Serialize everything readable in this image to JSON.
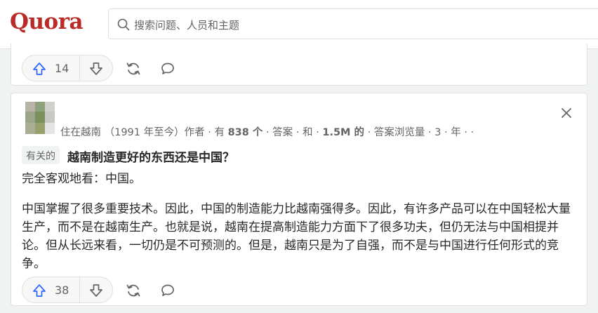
{
  "header": {
    "logo_text": "Quora",
    "search": {
      "placeholder": "搜索问题、人员和主题"
    }
  },
  "colors": {
    "brand": "#b92b27",
    "upvote_blue": "#2e69ff",
    "muted_text": "#636466",
    "border": "#dee0e1"
  },
  "previous_card": {
    "upvotes": "14"
  },
  "answer_card": {
    "author_line_plain": "住在越南 （1991 年至今）作者 · 有 ",
    "answers_count": "838 个",
    "author_line_mid": " · 答案 · 和 · ",
    "views_count": "1.5M 的",
    "author_line_end": " · 答案浏览量 · 3 · 年 · ·",
    "related_label": "有关的",
    "question": "越南制造更好的东西还是中国？",
    "paragraph_1": "完全客观地看：中国。",
    "paragraph_2": "中国掌握了很多重要技术。因此，中国的制造能力比越南强得多。因此，有许多产品可以在中国轻松大量生产，而不是在越南生产。也就是说，越南在提高制造能力方面下了很多功夫，但仍无法与中国相提并论。但从长远来看，一切仍是不可预测的。但是，越南只是为了自强，而不是与中国进行任何形式的竞争。",
    "upvotes": "38"
  },
  "icons": {
    "search": "search-icon",
    "upvote": "upvote-arrow-icon",
    "downvote": "downvote-arrow-icon",
    "share": "share-refresh-icon",
    "comment": "comment-bubble-icon",
    "close": "close-icon"
  }
}
